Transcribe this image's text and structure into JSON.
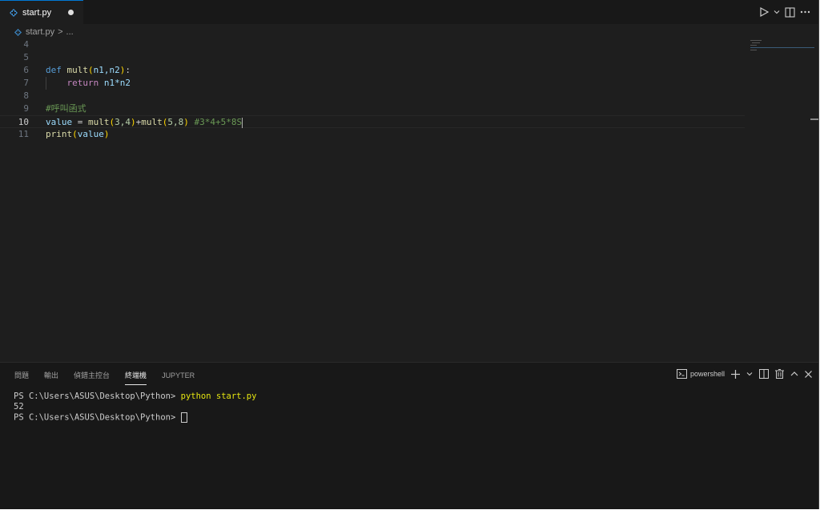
{
  "tab": {
    "filename": "start.py",
    "dirty": true
  },
  "breadcrumb": {
    "file": "start.py",
    "separator": ">",
    "more": "..."
  },
  "editor": {
    "lines": [
      {
        "number": "4"
      },
      {
        "number": "5"
      },
      {
        "number": "6"
      },
      {
        "number": "7"
      },
      {
        "number": "8"
      },
      {
        "number": "9"
      },
      {
        "number": "10"
      },
      {
        "number": "11"
      }
    ],
    "tokens": {
      "def": "def",
      "mult": "mult",
      "params": "n1,n2",
      "return": "return",
      "return_expr": "n1*n2",
      "comment_call": "#呼叫函式",
      "value": "value",
      "equals": " = ",
      "call1": "mult",
      "args1": "3,4",
      "plus": "+",
      "call2": "mult",
      "args2": "5,8",
      "comment_result": "#3*4+5*8S",
      "print": "print",
      "print_arg": "value"
    }
  },
  "panel": {
    "tabs": [
      "問題",
      "輸出",
      "偵錯主控台",
      "終端機",
      "JUPYTER"
    ],
    "active_tab": "終端機",
    "shell_name": "powershell"
  },
  "terminal": {
    "prompt": "PS C:\\Users\\ASUS\\Desktop\\Python> ",
    "command": "python start.py",
    "output": "52",
    "prompt2": "PS C:\\Users\\ASUS\\Desktop\\Python> "
  },
  "colors": {
    "accent": "#0078d4",
    "python_icon": "#3c8dcf"
  }
}
